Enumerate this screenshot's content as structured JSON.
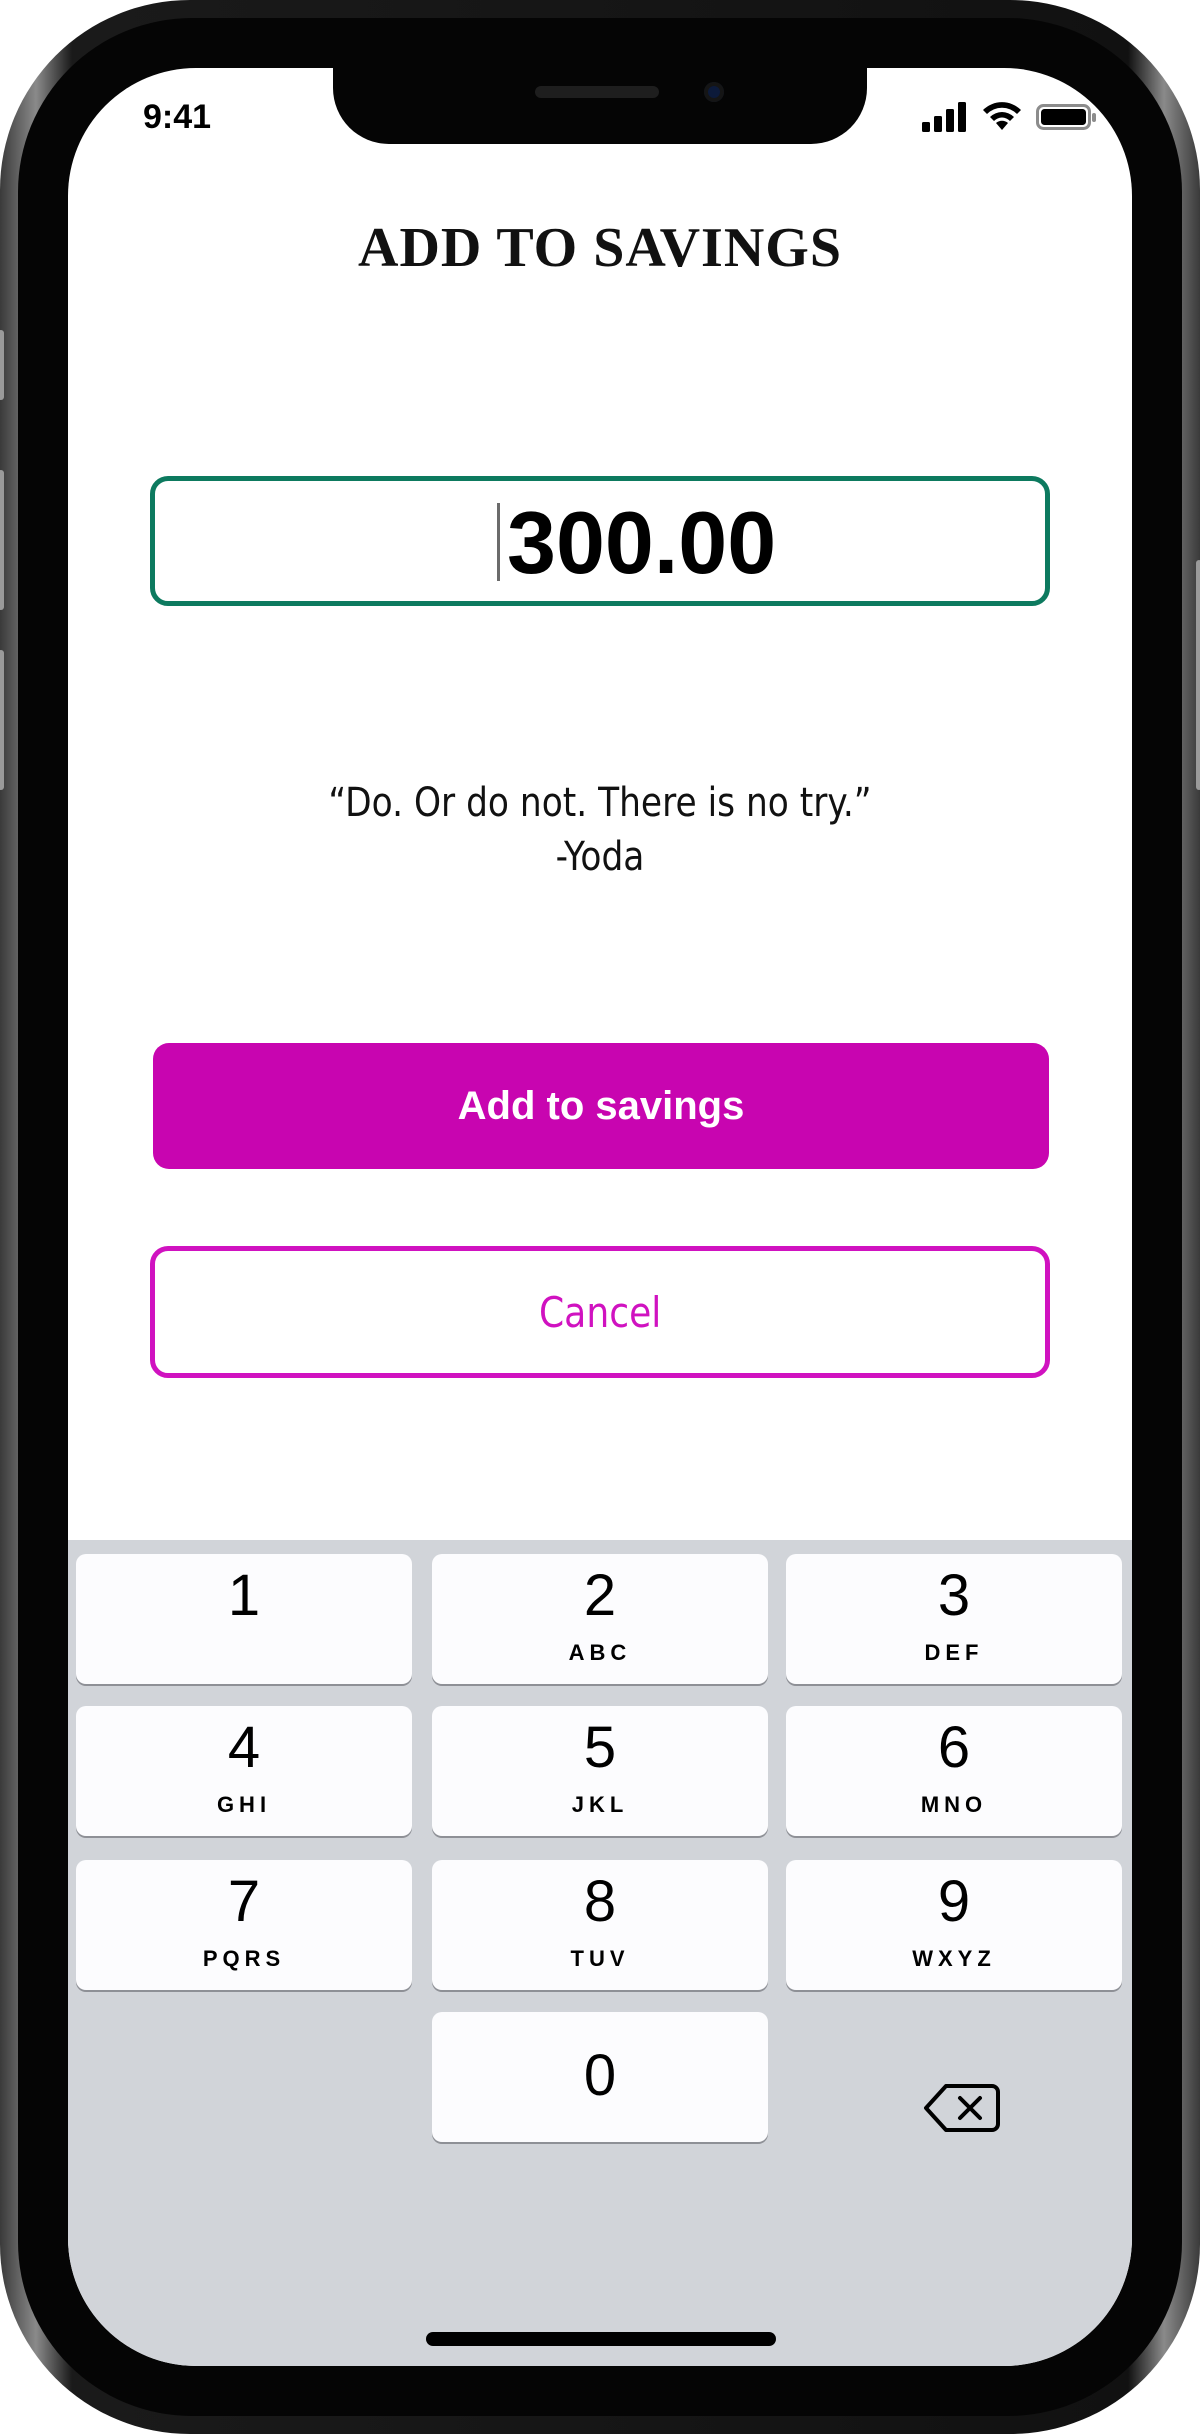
{
  "status_bar": {
    "time": "9:41",
    "icons": [
      "signal-icon",
      "wifi-icon",
      "battery-icon"
    ]
  },
  "screen": {
    "title": "ADD TO SAVINGS",
    "amount": {
      "value": "300.00"
    },
    "quote": {
      "text": "“Do. Or do not. There is no try.”",
      "author": "-Yoda"
    },
    "primary_button": "Add to savings",
    "cancel_button": "Cancel"
  },
  "keypad": {
    "keys": [
      {
        "digit": "1",
        "letters": ""
      },
      {
        "digit": "2",
        "letters": "ABC"
      },
      {
        "digit": "3",
        "letters": "DEF"
      },
      {
        "digit": "4",
        "letters": "GHI"
      },
      {
        "digit": "5",
        "letters": "JKL"
      },
      {
        "digit": "6",
        "letters": "MNO"
      },
      {
        "digit": "7",
        "letters": "PQRS"
      },
      {
        "digit": "8",
        "letters": "TUV"
      },
      {
        "digit": "9",
        "letters": "WXYZ"
      },
      {
        "digit": "0",
        "letters": ""
      }
    ],
    "backspace_icon": "backspace-icon"
  },
  "colors": {
    "accent": "#c805b0",
    "field_border": "#0d7a5f",
    "keyboard_bg": "#d1d4d9"
  }
}
